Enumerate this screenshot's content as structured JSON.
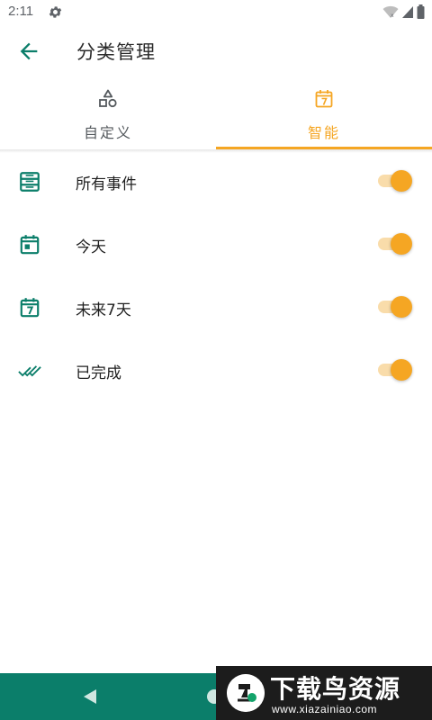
{
  "status_bar": {
    "time": "2:11",
    "icons": [
      "settings-icon",
      "wifi-icon",
      "signal-icon",
      "battery-icon"
    ]
  },
  "app_bar": {
    "back_icon": "arrow-back-icon",
    "title": "分类管理"
  },
  "tabs": [
    {
      "label": "自定义",
      "icon": "shapes-icon",
      "selected": false
    },
    {
      "label": "智能",
      "icon": "calendar-seven-icon",
      "selected": true
    }
  ],
  "list": {
    "items": [
      {
        "label": "所有事件",
        "icon": "inbox-stack-icon",
        "enabled": true
      },
      {
        "label": "今天",
        "icon": "calendar-today-icon",
        "enabled": true
      },
      {
        "label": "未来7天",
        "icon": "calendar-seven-icon",
        "enabled": true
      },
      {
        "label": "已完成",
        "icon": "double-check-icon",
        "enabled": true
      }
    ]
  },
  "nav_bar": {
    "icons": [
      "nav-back-icon",
      "nav-home-icon"
    ]
  },
  "watermark": {
    "title": "下载鸟资源",
    "url": "www.xiazainiao.com"
  },
  "colors": {
    "primary": "#0b7e6a",
    "accent": "#f5a623",
    "switch_track": "#f9dcaa",
    "icon_teal": "#0b7e6a"
  }
}
